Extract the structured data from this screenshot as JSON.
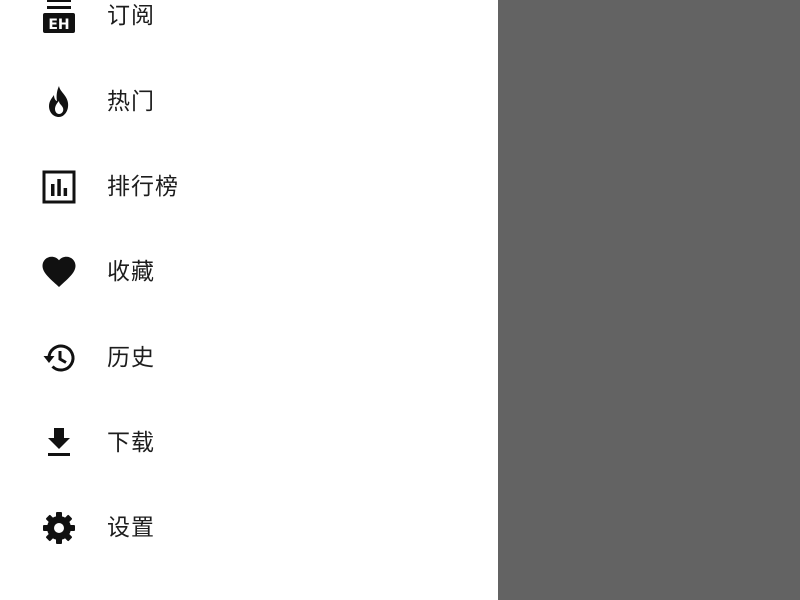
{
  "drawer": {
    "items": [
      {
        "label": "订阅",
        "icon": "eh-subscription-icon"
      },
      {
        "label": "热门",
        "icon": "fire-icon"
      },
      {
        "label": "排行榜",
        "icon": "leaderboard-icon"
      },
      {
        "label": "收藏",
        "icon": "heart-icon"
      },
      {
        "label": "历史",
        "icon": "history-icon"
      },
      {
        "label": "下载",
        "icon": "download-icon"
      },
      {
        "label": "设置",
        "icon": "settings-icon"
      }
    ]
  },
  "scrim": {
    "color": "#636363"
  },
  "colors": {
    "icon": "#111111",
    "text": "#1d1d1d",
    "background": "#ffffff"
  }
}
